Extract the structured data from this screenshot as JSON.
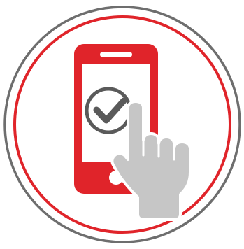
{
  "icon": {
    "name": "phone-tap-confirm-icon",
    "colors": {
      "background": "#ffffff",
      "outer_ring": "#6e6e6e",
      "inner_ring": "#e0242a",
      "phone_body": "#e0242a",
      "phone_screen": "#ffffff",
      "check_circle": "#5a5a5a",
      "check_mark": "#5a5a5a",
      "hand_fill": "#c6c6c6"
    }
  }
}
